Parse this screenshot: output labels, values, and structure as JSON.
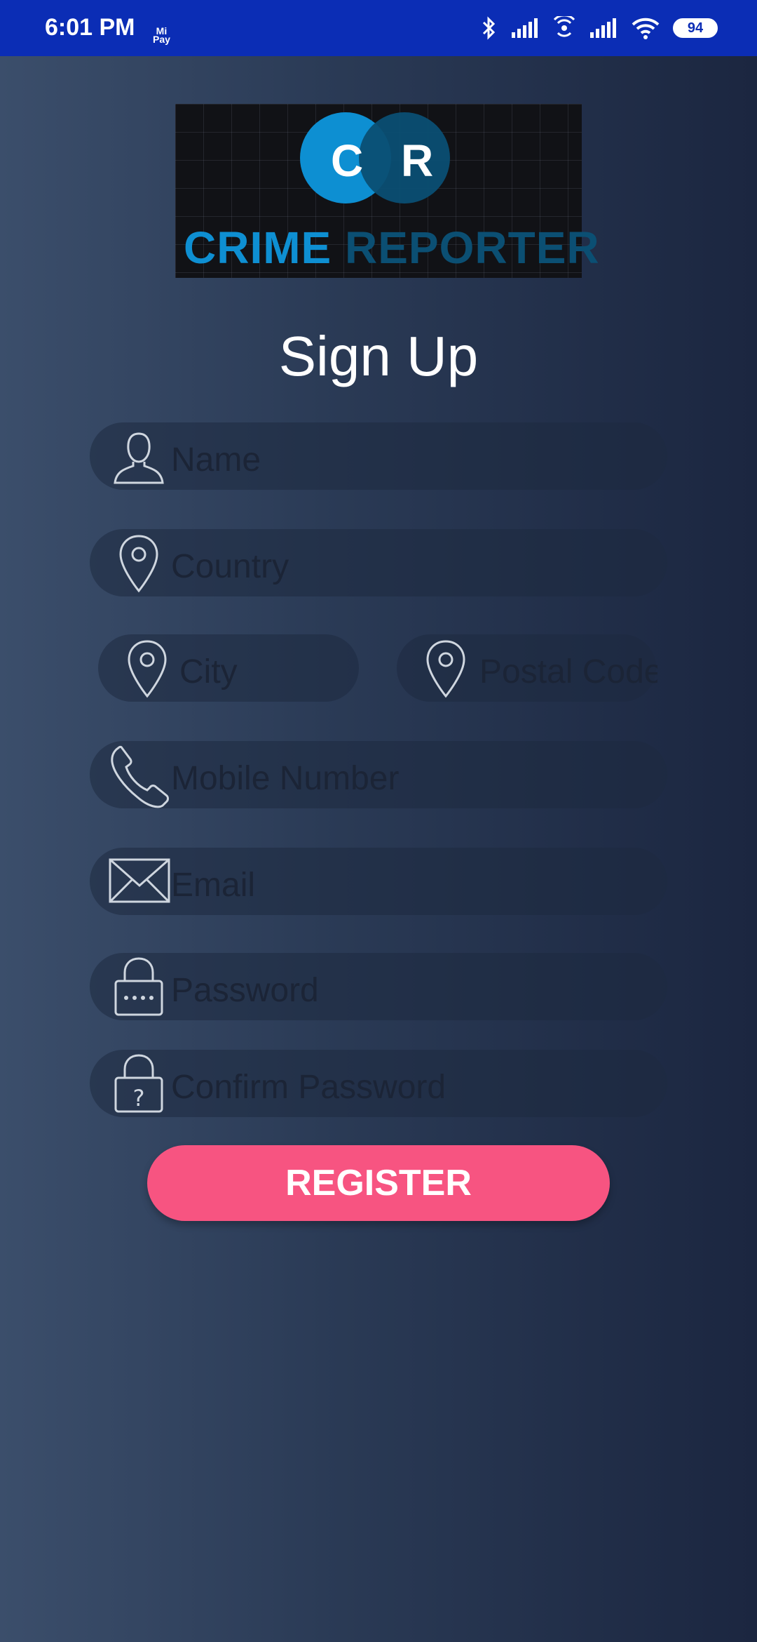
{
  "status_bar": {
    "time": "6:01 PM",
    "pay_badge": "Mi Pay",
    "battery": "94"
  },
  "logo": {
    "letter_c": "C",
    "letter_r": "R",
    "word1": "CRIME",
    "word2": "REPORTER"
  },
  "title": "Sign Up",
  "fields": {
    "name": "Name",
    "country": "Country",
    "city": "City",
    "postal": "Postal Code",
    "mobile": "Mobile Number",
    "email": "Email",
    "password": "Password",
    "confirm_password": "Confirm Password"
  },
  "register_label": "REGISTER",
  "colors": {
    "status_bar": "#0b2db5",
    "button": "#f75481",
    "logo_blue": "#0e8fd2",
    "logo_dark": "#0b4f73"
  }
}
